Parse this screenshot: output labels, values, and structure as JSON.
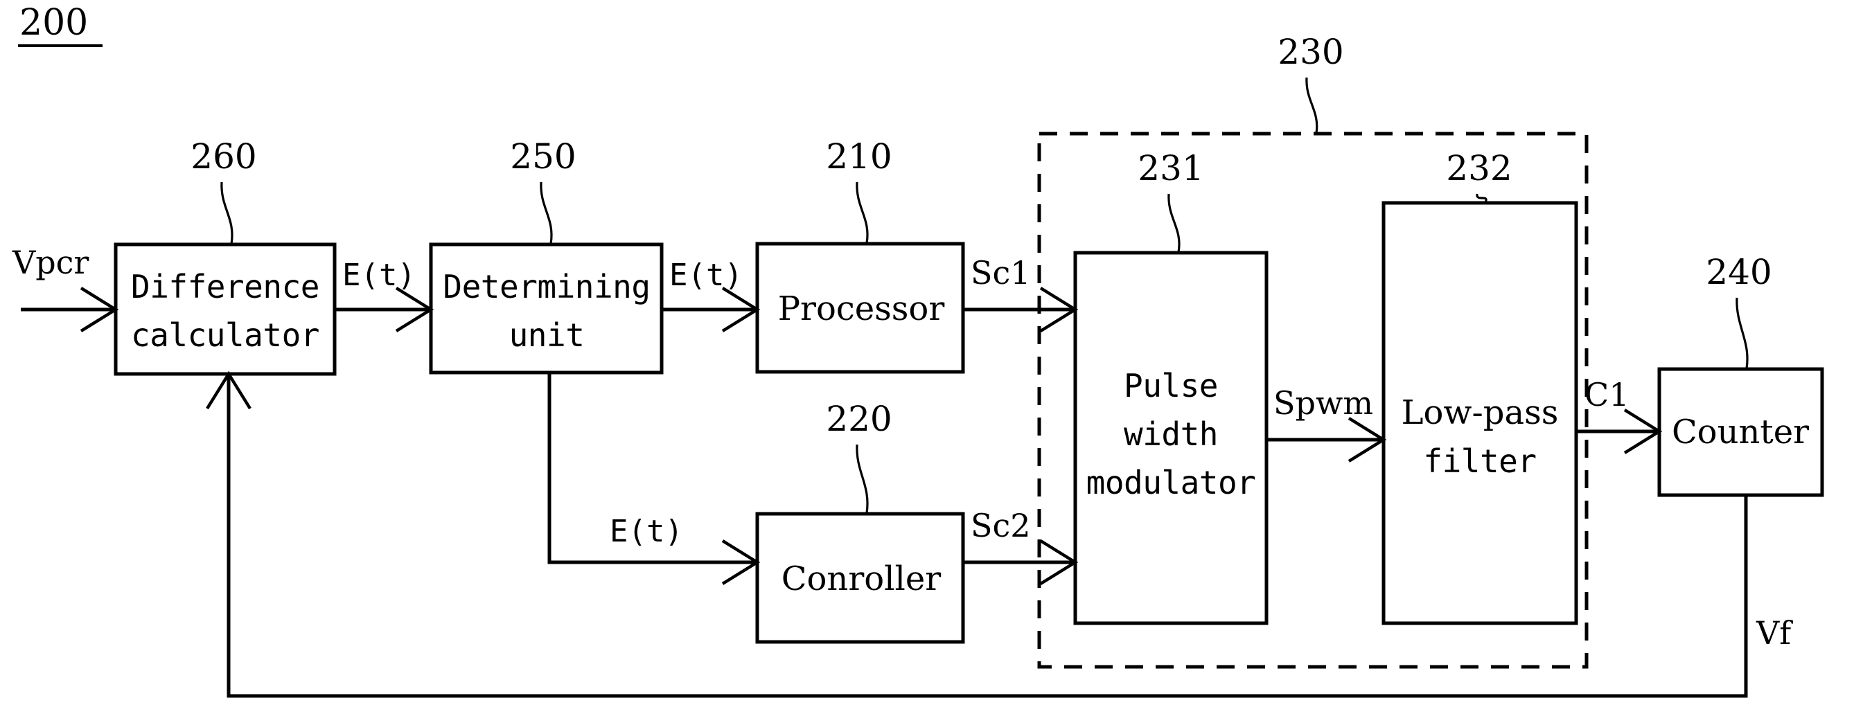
{
  "figure": {
    "number": "200",
    "type": "block-diagram"
  },
  "blocks": {
    "difference_calculator": {
      "ref": "260",
      "line1": "Difference",
      "line2": "calculator"
    },
    "determining_unit": {
      "ref": "250",
      "line1": "Determining",
      "line2": "unit"
    },
    "processor": {
      "ref": "210",
      "line1": "Processor"
    },
    "conroller": {
      "ref": "220",
      "line1": "Conroller"
    },
    "pulse_width_modulator": {
      "ref": "231",
      "line1": "Pulse",
      "line2": "width",
      "line3": "modulator"
    },
    "low_pass_filter": {
      "ref": "232",
      "line1": "Low-pass",
      "line2": "filter"
    },
    "counter": {
      "ref": "240",
      "line1": "Counter"
    },
    "group": {
      "ref": "230"
    }
  },
  "signals": {
    "input": "Vpcr",
    "err1": "E(t)",
    "err2": "E(t)",
    "err3": "E(t)",
    "sc1": "Sc1",
    "sc2": "Sc2",
    "spwm": "Spwm",
    "c1": "C1",
    "vf": "Vf"
  },
  "colors": {
    "stroke": "#000000",
    "background": "#ffffff"
  }
}
